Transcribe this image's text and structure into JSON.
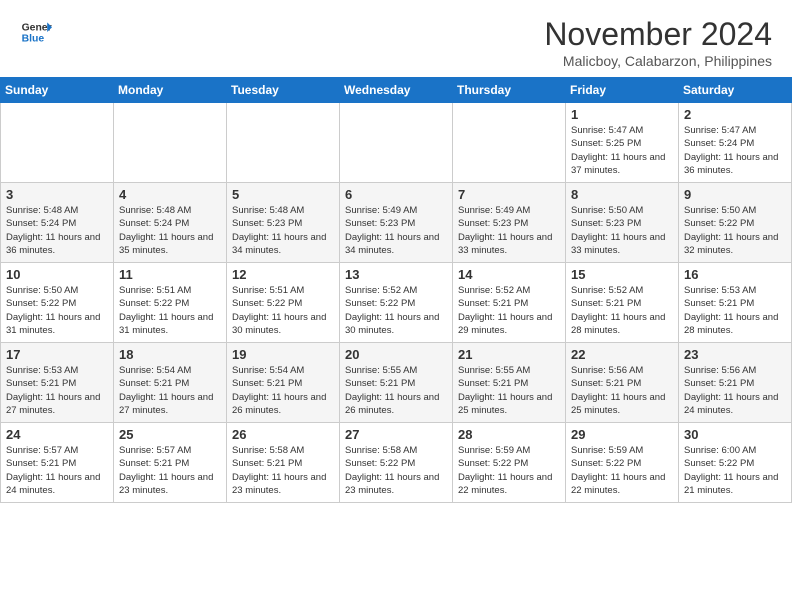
{
  "header": {
    "logo_line1": "General",
    "logo_line2": "Blue",
    "month": "November 2024",
    "location": "Malicboy, Calabarzon, Philippines"
  },
  "days_of_week": [
    "Sunday",
    "Monday",
    "Tuesday",
    "Wednesday",
    "Thursday",
    "Friday",
    "Saturday"
  ],
  "weeks": [
    [
      {
        "day": "",
        "info": ""
      },
      {
        "day": "",
        "info": ""
      },
      {
        "day": "",
        "info": ""
      },
      {
        "day": "",
        "info": ""
      },
      {
        "day": "",
        "info": ""
      },
      {
        "day": "1",
        "info": "Sunrise: 5:47 AM\nSunset: 5:25 PM\nDaylight: 11 hours and 37 minutes."
      },
      {
        "day": "2",
        "info": "Sunrise: 5:47 AM\nSunset: 5:24 PM\nDaylight: 11 hours and 36 minutes."
      }
    ],
    [
      {
        "day": "3",
        "info": "Sunrise: 5:48 AM\nSunset: 5:24 PM\nDaylight: 11 hours and 36 minutes."
      },
      {
        "day": "4",
        "info": "Sunrise: 5:48 AM\nSunset: 5:24 PM\nDaylight: 11 hours and 35 minutes."
      },
      {
        "day": "5",
        "info": "Sunrise: 5:48 AM\nSunset: 5:23 PM\nDaylight: 11 hours and 34 minutes."
      },
      {
        "day": "6",
        "info": "Sunrise: 5:49 AM\nSunset: 5:23 PM\nDaylight: 11 hours and 34 minutes."
      },
      {
        "day": "7",
        "info": "Sunrise: 5:49 AM\nSunset: 5:23 PM\nDaylight: 11 hours and 33 minutes."
      },
      {
        "day": "8",
        "info": "Sunrise: 5:50 AM\nSunset: 5:23 PM\nDaylight: 11 hours and 33 minutes."
      },
      {
        "day": "9",
        "info": "Sunrise: 5:50 AM\nSunset: 5:22 PM\nDaylight: 11 hours and 32 minutes."
      }
    ],
    [
      {
        "day": "10",
        "info": "Sunrise: 5:50 AM\nSunset: 5:22 PM\nDaylight: 11 hours and 31 minutes."
      },
      {
        "day": "11",
        "info": "Sunrise: 5:51 AM\nSunset: 5:22 PM\nDaylight: 11 hours and 31 minutes."
      },
      {
        "day": "12",
        "info": "Sunrise: 5:51 AM\nSunset: 5:22 PM\nDaylight: 11 hours and 30 minutes."
      },
      {
        "day": "13",
        "info": "Sunrise: 5:52 AM\nSunset: 5:22 PM\nDaylight: 11 hours and 30 minutes."
      },
      {
        "day": "14",
        "info": "Sunrise: 5:52 AM\nSunset: 5:21 PM\nDaylight: 11 hours and 29 minutes."
      },
      {
        "day": "15",
        "info": "Sunrise: 5:52 AM\nSunset: 5:21 PM\nDaylight: 11 hours and 28 minutes."
      },
      {
        "day": "16",
        "info": "Sunrise: 5:53 AM\nSunset: 5:21 PM\nDaylight: 11 hours and 28 minutes."
      }
    ],
    [
      {
        "day": "17",
        "info": "Sunrise: 5:53 AM\nSunset: 5:21 PM\nDaylight: 11 hours and 27 minutes."
      },
      {
        "day": "18",
        "info": "Sunrise: 5:54 AM\nSunset: 5:21 PM\nDaylight: 11 hours and 27 minutes."
      },
      {
        "day": "19",
        "info": "Sunrise: 5:54 AM\nSunset: 5:21 PM\nDaylight: 11 hours and 26 minutes."
      },
      {
        "day": "20",
        "info": "Sunrise: 5:55 AM\nSunset: 5:21 PM\nDaylight: 11 hours and 26 minutes."
      },
      {
        "day": "21",
        "info": "Sunrise: 5:55 AM\nSunset: 5:21 PM\nDaylight: 11 hours and 25 minutes."
      },
      {
        "day": "22",
        "info": "Sunrise: 5:56 AM\nSunset: 5:21 PM\nDaylight: 11 hours and 25 minutes."
      },
      {
        "day": "23",
        "info": "Sunrise: 5:56 AM\nSunset: 5:21 PM\nDaylight: 11 hours and 24 minutes."
      }
    ],
    [
      {
        "day": "24",
        "info": "Sunrise: 5:57 AM\nSunset: 5:21 PM\nDaylight: 11 hours and 24 minutes."
      },
      {
        "day": "25",
        "info": "Sunrise: 5:57 AM\nSunset: 5:21 PM\nDaylight: 11 hours and 23 minutes."
      },
      {
        "day": "26",
        "info": "Sunrise: 5:58 AM\nSunset: 5:21 PM\nDaylight: 11 hours and 23 minutes."
      },
      {
        "day": "27",
        "info": "Sunrise: 5:58 AM\nSunset: 5:22 PM\nDaylight: 11 hours and 23 minutes."
      },
      {
        "day": "28",
        "info": "Sunrise: 5:59 AM\nSunset: 5:22 PM\nDaylight: 11 hours and 22 minutes."
      },
      {
        "day": "29",
        "info": "Sunrise: 5:59 AM\nSunset: 5:22 PM\nDaylight: 11 hours and 22 minutes."
      },
      {
        "day": "30",
        "info": "Sunrise: 6:00 AM\nSunset: 5:22 PM\nDaylight: 11 hours and 21 minutes."
      }
    ]
  ]
}
